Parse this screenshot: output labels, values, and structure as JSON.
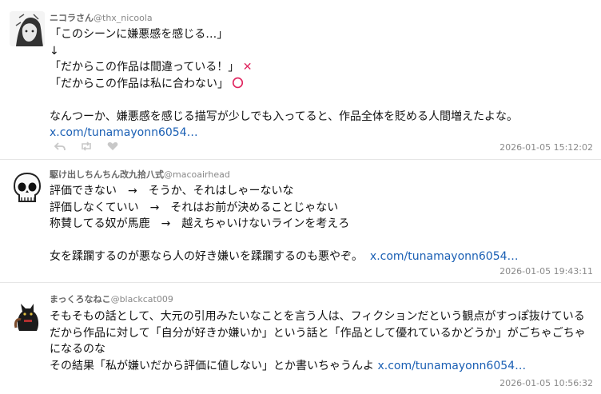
{
  "tweets": [
    {
      "name": "ニコラさん",
      "handle": "@thx_nicoola",
      "lines": [
        "「このシーンに嫌悪感を感じる…」",
        "↓",
        "「だからこの作品は間違っている！」",
        "「だからこの作品は私に合わない」",
        "",
        "なんつーか、嫌悪感を感じる描写が少しでも入ってると、作品全体を貶める人間増えたよな。"
      ],
      "mark_wrong": "✕",
      "mark_right": "〇",
      "link": "x.com/tunamayonn6054…",
      "timestamp": "2026-01-05 15:12:02"
    },
    {
      "name": "駆け出しちんちん改九拾八式",
      "handle": "@macoairhead",
      "lines": [
        "評価できない　→　そうか、それはしゃーないな",
        "評価しなくていい　→　それはお前が決めることじゃない",
        "称賛してる奴が馬鹿　→　越えちゃいけないラインを考えろ",
        "",
        "女を蹂躙するのが悪なら人の好き嫌いを蹂躙するのも悪やぞ。"
      ],
      "link": "x.com/tunamayonn6054…",
      "timestamp": "2026-01-05 19:43:11"
    },
    {
      "name": "まっくろなねこ",
      "handle": "@blackcat009",
      "lines": [
        "そもそもの話として、大元の引用みたいなことを言う人は、フィクションだという観点がすっぽ抜けている",
        "だから作品に対して「自分が好きか嫌いか」という話と「作品として優れているかどうか」がごちゃごちゃ",
        "になるのな",
        "その結果「私が嫌いだから評価に値しない」とか書いちゃうんよ"
      ],
      "link": "x.com/tunamayonn6054…",
      "timestamp": "2026-01-05 10:56:32"
    }
  ]
}
